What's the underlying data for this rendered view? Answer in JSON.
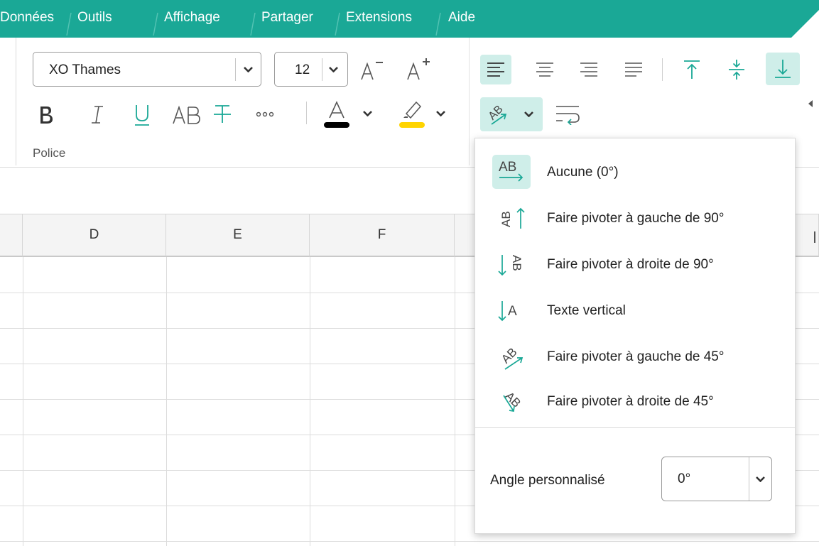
{
  "menu": {
    "tabs": [
      "Données",
      "Outils",
      "Affichage",
      "Partager",
      "Extensions",
      "Aide"
    ]
  },
  "ribbon": {
    "font_name": "XO Thames",
    "font_size": "12",
    "group_label": "Police",
    "colors": {
      "accent": "#1aa896",
      "font_color": "#000000",
      "highlight": "#ffd400",
      "active_bg": "#cfeee9"
    }
  },
  "columns": [
    "D",
    "E",
    "F"
  ],
  "orientation_menu": {
    "items": [
      {
        "label": "Aucune (0°)",
        "icon": "text-horizontal-icon",
        "selected": true
      },
      {
        "label": "Faire pivoter à gauche de 90°",
        "icon": "rotate-left-90-icon",
        "selected": false
      },
      {
        "label": "Faire pivoter à droite de 90°",
        "icon": "rotate-right-90-icon",
        "selected": false
      },
      {
        "label": "Texte vertical",
        "icon": "text-vertical-icon",
        "selected": false
      },
      {
        "label": "Faire pivoter à gauche de 45°",
        "icon": "rotate-left-45-icon",
        "selected": false
      },
      {
        "label": "Faire pivoter à droite de 45°",
        "icon": "rotate-right-45-icon",
        "selected": false
      }
    ],
    "custom_angle_label": "Angle personnalisé",
    "custom_angle_value": "0°"
  }
}
